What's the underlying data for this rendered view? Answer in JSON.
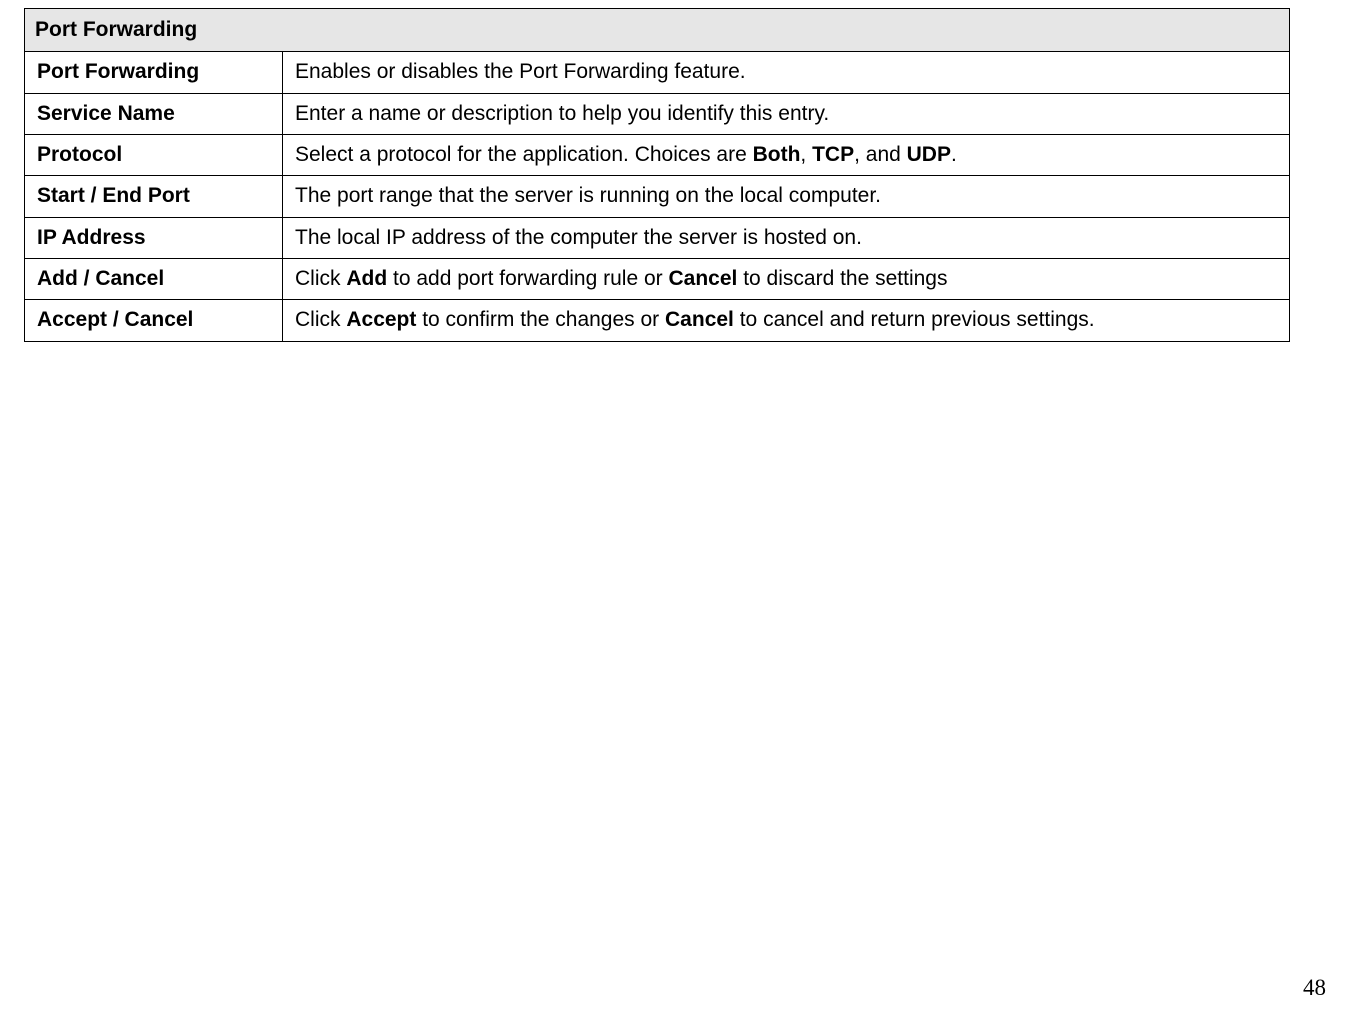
{
  "table": {
    "title": "Port Forwarding",
    "rows": [
      {
        "label": "Port Forwarding",
        "parts": [
          "Enables or disables the Port Forwarding feature."
        ],
        "bold": []
      },
      {
        "label": "Service Name",
        "parts": [
          "Enter a name or description to help you identify this entry."
        ],
        "bold": []
      },
      {
        "label": "Protocol",
        "parts": [
          "Select a protocol for the application. Choices are ",
          "Both",
          ", ",
          "TCP",
          ", and ",
          "UDP",
          "."
        ],
        "bold": [
          1,
          3,
          5
        ]
      },
      {
        "label": "Start / End Port",
        "parts": [
          "The port range that the server is running on the local computer."
        ],
        "bold": []
      },
      {
        "label": "IP Address",
        "parts": [
          "The local IP address of the computer the server is hosted on."
        ],
        "bold": []
      },
      {
        "label": "Add / Cancel",
        "parts": [
          "Click ",
          "Add",
          " to add port forwarding rule or ",
          "Cancel",
          " to discard the settings"
        ],
        "bold": [
          1,
          3
        ]
      },
      {
        "label": "Accept / Cancel",
        "parts": [
          "Click ",
          "Accept",
          " to confirm the changes or ",
          "Cancel",
          " to cancel and return previous settings."
        ],
        "bold": [
          1,
          3
        ]
      }
    ]
  },
  "page_number": "48"
}
